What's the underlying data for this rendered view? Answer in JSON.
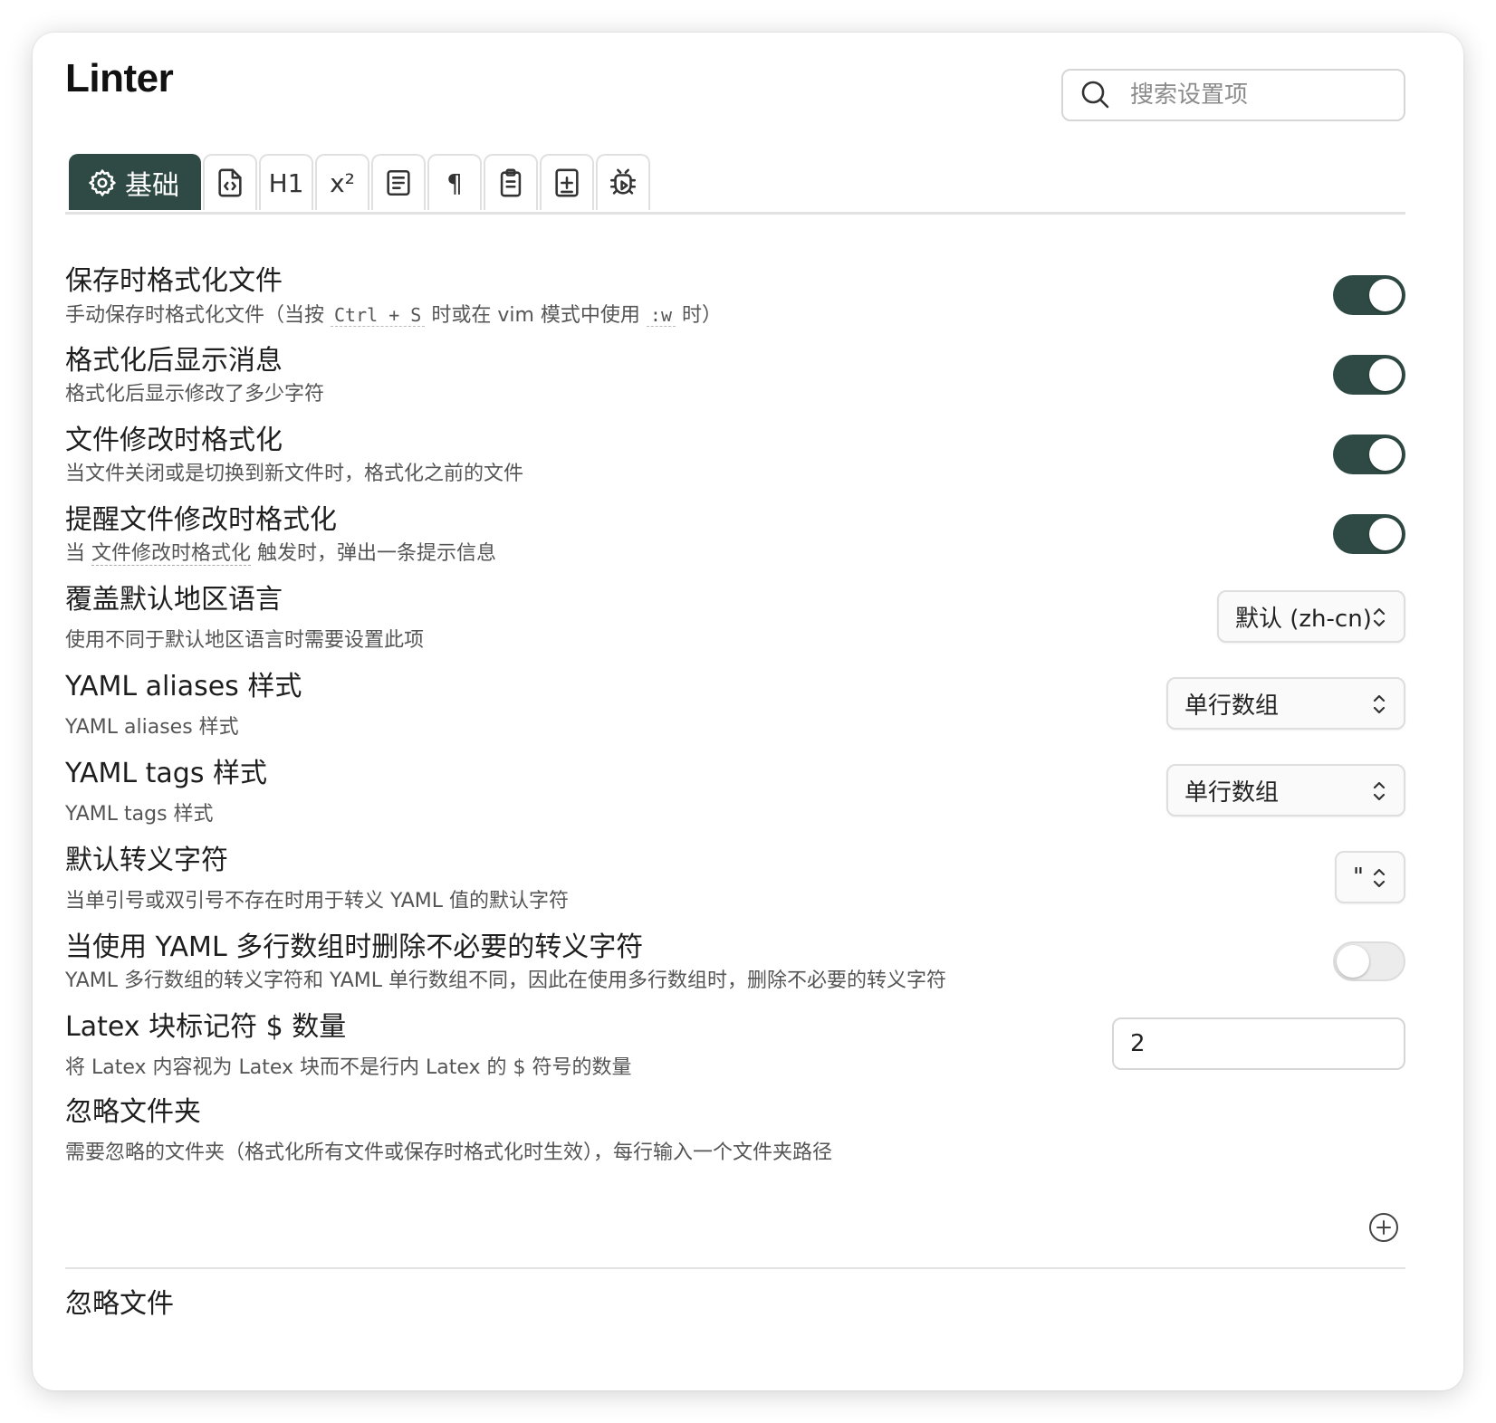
{
  "app": {
    "title": "Linter"
  },
  "search": {
    "placeholder": "搜索设置项"
  },
  "tabs": [
    {
      "label": "基础",
      "icon": "gear-icon",
      "active": true
    },
    {
      "label": "",
      "icon": "file-code-icon"
    },
    {
      "label": "H1",
      "icon": "heading-icon"
    },
    {
      "label": "x²",
      "icon": "superscript-icon"
    },
    {
      "label": "",
      "icon": "text-block-icon"
    },
    {
      "label": "¶",
      "icon": "pilcrow-icon"
    },
    {
      "label": "",
      "icon": "clipboard-icon"
    },
    {
      "label": "",
      "icon": "file-plus-icon"
    },
    {
      "label": "",
      "icon": "bug-play-icon"
    }
  ],
  "settings": {
    "format_on_save": {
      "name": "保存时格式化文件",
      "desc_prefix": "手动保存时格式化文件（当按",
      "code1": "Ctrl + S",
      "desc_mid": "时或在 vim 模式中使用",
      "code2": ":w",
      "desc_suffix": "时）",
      "enabled": true
    },
    "show_message": {
      "name": "格式化后显示消息",
      "desc": "格式化后显示修改了多少字符",
      "enabled": true
    },
    "format_on_change": {
      "name": "文件修改时格式化",
      "desc": "当文件关闭或是切换到新文件时，格式化之前的文件",
      "enabled": true
    },
    "notify_on_change": {
      "name": "提醒文件修改时格式化",
      "desc_prefix": "当",
      "desc_ref": "文件修改时格式化",
      "desc_suffix": "触发时，弹出一条提示信息",
      "enabled": true
    },
    "locale": {
      "name": "覆盖默认地区语言",
      "desc": "使用不同于默认地区语言时需要设置此项",
      "value": "默认 (zh-cn)"
    },
    "yaml_aliases": {
      "name": "YAML aliases 样式",
      "desc": "YAML aliases 样式",
      "value": "单行数组"
    },
    "yaml_tags": {
      "name": "YAML tags 样式",
      "desc": "YAML tags 样式",
      "value": "单行数组"
    },
    "escape_char": {
      "name": "默认转义字符",
      "desc": "当单引号或双引号不存在时用于转义 YAML 值的默认字符",
      "value": "\""
    },
    "remove_escape": {
      "name": "当使用 YAML 多行数组时删除不必要的转义字符",
      "desc": "YAML 多行数组的转义字符和 YAML 单行数组不同，因此在使用多行数组时，删除不必要的转义字符",
      "enabled": false
    },
    "latex_dollars": {
      "name": "Latex 块标记符 $ 数量",
      "desc": "将 Latex 内容视为 Latex 块而不是行内 Latex 的 $ 符号的数量",
      "value": "2"
    },
    "ignore_folders": {
      "name": "忽略文件夹",
      "desc": "需要忽略的文件夹（格式化所有文件或保存时格式化时生效），每行输入一个文件夹路径"
    },
    "ignore_files": {
      "name": "忽略文件"
    }
  },
  "colors": {
    "accent": "#2f4a44",
    "toggle_off": "#ececec"
  }
}
